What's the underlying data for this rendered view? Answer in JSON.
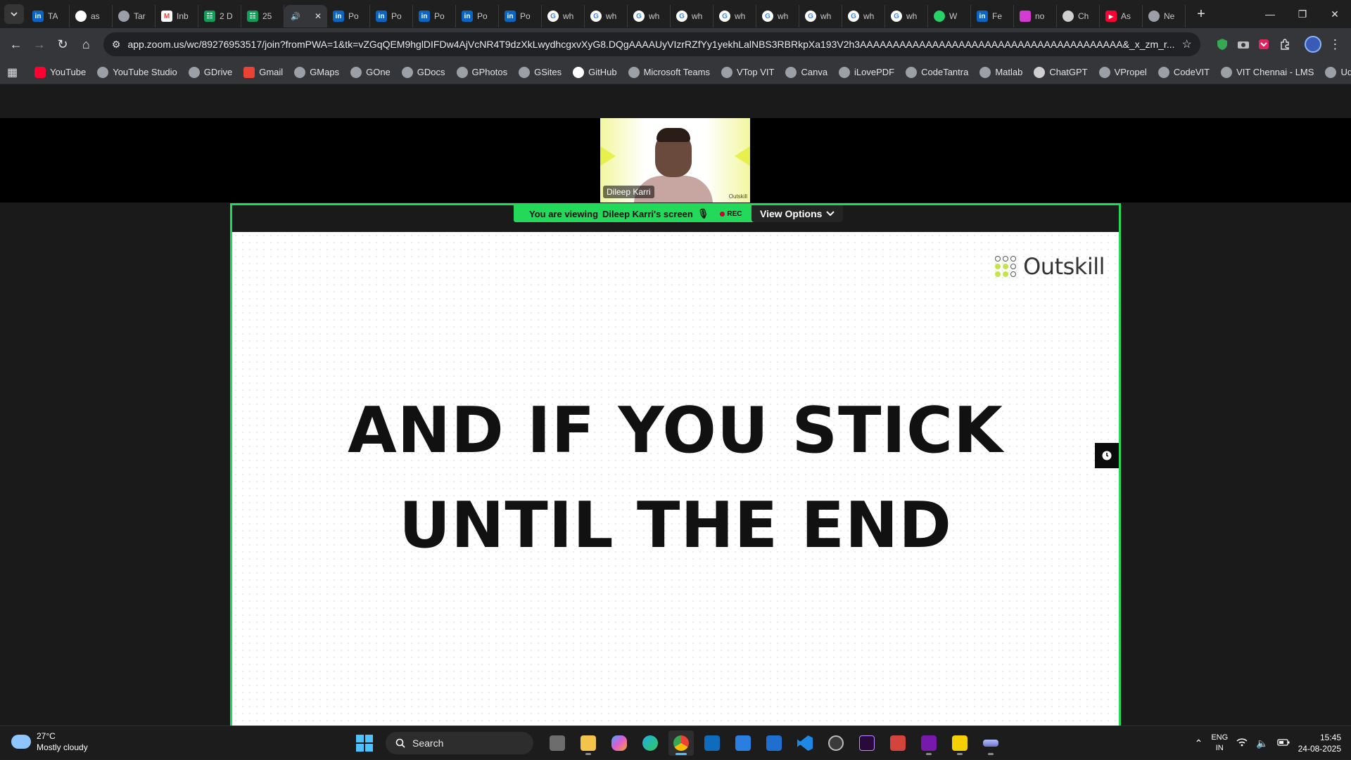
{
  "browser": {
    "tabs": [
      {
        "icon": "linkedin-icon",
        "title": "TA",
        "color": "#0a66c2"
      },
      {
        "icon": "github-icon",
        "title": "as",
        "color": "#ffffff"
      },
      {
        "icon": "globe-icon",
        "title": "Tar",
        "color": "#9aa0a6"
      },
      {
        "icon": "gmail-icon",
        "title": "Inb",
        "color": "#ea4335"
      },
      {
        "icon": "sheets-icon",
        "title": "2 D",
        "color": "#0f9d58"
      },
      {
        "icon": "sheets-icon",
        "title": "25",
        "color": "#0f9d58"
      },
      {
        "icon": "audio-icon",
        "title": "",
        "color": "#e3e3e3",
        "active": true
      },
      {
        "icon": "linkedin-icon",
        "title": "Po",
        "color": "#0a66c2"
      },
      {
        "icon": "linkedin-icon",
        "title": "Po",
        "color": "#0a66c2"
      },
      {
        "icon": "linkedin-icon",
        "title": "Po",
        "color": "#0a66c2"
      },
      {
        "icon": "linkedin-icon",
        "title": "Po",
        "color": "#0a66c2"
      },
      {
        "icon": "linkedin-icon",
        "title": "Po",
        "color": "#0a66c2"
      },
      {
        "icon": "google-icon",
        "title": "wh",
        "color": "#ffffff"
      },
      {
        "icon": "google-icon",
        "title": "wh",
        "color": "#ffffff"
      },
      {
        "icon": "google-icon",
        "title": "wh",
        "color": "#ffffff"
      },
      {
        "icon": "google-icon",
        "title": "wh",
        "color": "#ffffff"
      },
      {
        "icon": "google-icon",
        "title": "wh",
        "color": "#ffffff"
      },
      {
        "icon": "google-icon",
        "title": "wh",
        "color": "#ffffff"
      },
      {
        "icon": "google-icon",
        "title": "wh",
        "color": "#ffffff"
      },
      {
        "icon": "google-icon",
        "title": "wh",
        "color": "#ffffff"
      },
      {
        "icon": "google-icon",
        "title": "wh",
        "color": "#ffffff"
      },
      {
        "icon": "whatsapp-icon",
        "title": "W",
        "color": "#25d366"
      },
      {
        "icon": "linkedin-icon",
        "title": "Fe",
        "color": "#0a66c2"
      },
      {
        "icon": "pen-icon",
        "title": "no",
        "color": "#d33bd3"
      },
      {
        "icon": "chatgpt-icon",
        "title": "Ch",
        "color": "#cfcfcf"
      },
      {
        "icon": "youtube-icon",
        "title": "As",
        "color": "#ff0033"
      },
      {
        "icon": "globe-icon",
        "title": "Ne",
        "color": "#9aa0a6"
      }
    ],
    "url": "app.zoom.us/wc/89276953517/join?fromPWA=1&tk=vZGqQEM9hglDIFDw4AjVcNR4T9dzXkLwydhcgxvXyG8.DQgAAAAUyVIzrRZfYy1yekhLalNBS3RBRkpXa193V2h3AAAAAAAAAAAAAAAAAAAAAAAAAAAAAAAAAAAAAAAA&_x_zm_r...",
    "bookmarks": [
      {
        "label": "YouTube",
        "icon": "yt"
      },
      {
        "label": "YouTube Studio",
        "icon": "globe"
      },
      {
        "label": "GDrive",
        "icon": "globe"
      },
      {
        "label": "Gmail",
        "icon": "gm"
      },
      {
        "label": "GMaps",
        "icon": "globe"
      },
      {
        "label": "GOne",
        "icon": "globe"
      },
      {
        "label": "GDocs",
        "icon": "globe"
      },
      {
        "label": "GPhotos",
        "icon": "globe"
      },
      {
        "label": "GSites",
        "icon": "globe"
      },
      {
        "label": "GitHub",
        "icon": "gh"
      },
      {
        "label": "Microsoft Teams",
        "icon": "globe"
      },
      {
        "label": "VTop VIT",
        "icon": "globe"
      },
      {
        "label": "Canva",
        "icon": "globe"
      },
      {
        "label": "iLovePDF",
        "icon": "globe"
      },
      {
        "label": "CodeTantra",
        "icon": "globe"
      },
      {
        "label": "Matlab",
        "icon": "globe"
      },
      {
        "label": "ChatGPT",
        "icon": "gpt"
      },
      {
        "label": "VPropel",
        "icon": "globe"
      },
      {
        "label": "CodeVIT",
        "icon": "globe"
      },
      {
        "label": "VIT Chennai - LMS",
        "icon": "globe"
      },
      {
        "label": "Udemy",
        "icon": "globe"
      }
    ]
  },
  "zoom": {
    "participant_name": "Dileep Karri",
    "tile_logo": "Outskill",
    "viewing_prefix": "You are viewing",
    "viewing_name": "Dileep Karri's screen",
    "rec_label": "REC",
    "view_options": "View Options",
    "accent": "#23d959"
  },
  "slide": {
    "brand": "Outskill",
    "line1": "AND IF YOU STICK",
    "line2": "UNTIL THE END"
  },
  "taskbar": {
    "temperature": "27°C",
    "weather": "Mostly cloudy",
    "search_placeholder": "Search",
    "lang_top": "ENG",
    "lang_bottom": "IN",
    "time": "15:45",
    "date": "24-08-2025"
  }
}
